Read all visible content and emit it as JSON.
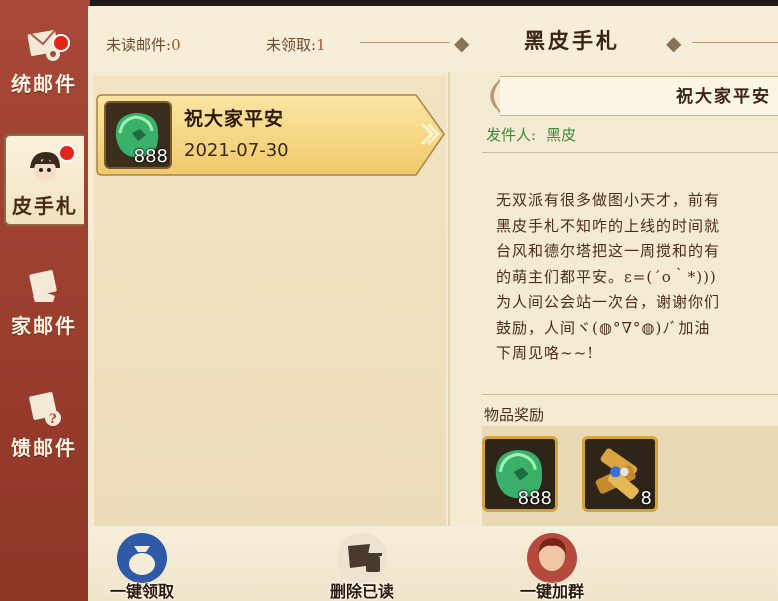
{
  "sidebar": {
    "items": [
      {
        "label": "统邮件",
        "icon": "mail-gear-icon",
        "badge": true
      },
      {
        "label": "皮手札",
        "icon": "chibi-character-icon",
        "badge": true,
        "active": true
      },
      {
        "label": "家邮件",
        "icon": "mail-hand-icon",
        "badge": false
      },
      {
        "label": "馈邮件",
        "icon": "mail-question-icon",
        "badge": false
      }
    ]
  },
  "header": {
    "unread_label": "未读邮件:",
    "unread_count": "0",
    "unclaimed_label": "未领取:",
    "unclaimed_count": "1",
    "title": "黑皮手札"
  },
  "mail_list": [
    {
      "title": "祝大家平安",
      "date": "2021-07-30",
      "item_icon": "jade-icon",
      "item_qty": "888"
    }
  ],
  "detail": {
    "subject": "祝大家平安",
    "sender_label": "发件人:",
    "sender_name": "黑皮",
    "body_lines": [
      "无双派有很多做图小天才，前有",
      "黑皮手札不知咋的上线的时间就",
      "台风和德尔塔把这一周搅和的有",
      "的萌主们都平安。ε=(´ο｀*)))",
      "为人间公会站一次台，谢谢你们",
      "鼓励，人间ヾ(◍°∇°◍)ﾉﾞ加油",
      "下周见咯~~!"
    ],
    "reward_label": "物品奖励",
    "rewards": [
      {
        "icon": "jade-icon",
        "qty": "888"
      },
      {
        "icon": "scroll-bundle-icon",
        "qty": "8"
      }
    ]
  },
  "bottom": {
    "claim_all": "一键领取",
    "delete_read": "删除已读",
    "join_group": "一键加群"
  },
  "colors": {
    "sidebar": "#9a3d2d",
    "panel": "#f5ead2",
    "accent_gold": "#f3d27a",
    "badge": "#e52418",
    "sender_green": "#3f8a3a"
  }
}
